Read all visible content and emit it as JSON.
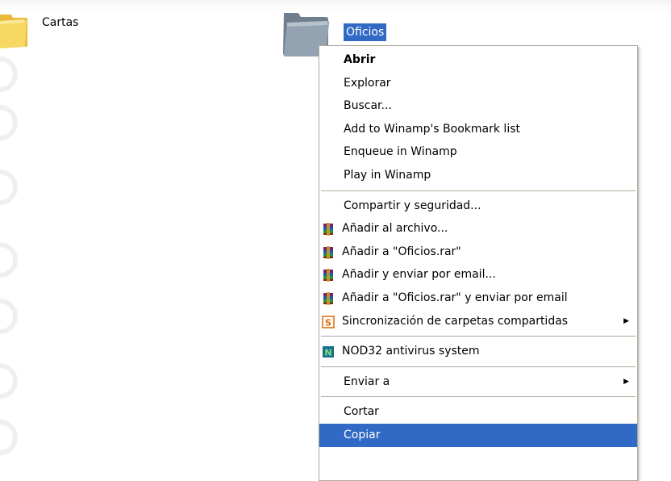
{
  "desktop": {
    "items": [
      {
        "label": "Cartas"
      },
      {
        "label": "Oficios"
      }
    ]
  },
  "context_menu": {
    "groups": [
      [
        {
          "label": "Abrir",
          "bold": true
        },
        {
          "label": "Explorar"
        },
        {
          "label": "Buscar..."
        },
        {
          "label": "Add to Winamp's Bookmark list"
        },
        {
          "label": "Enqueue in Winamp"
        },
        {
          "label": "Play in Winamp"
        }
      ],
      [
        {
          "label": "Compartir y seguridad..."
        },
        {
          "label": "Añadir al archivo...",
          "icon": "winrar-icon"
        },
        {
          "label": "Añadir a \"Oficios.rar\"",
          "icon": "winrar-icon"
        },
        {
          "label": "Añadir y enviar por email...",
          "icon": "winrar-icon"
        },
        {
          "label": "Añadir a \"Oficios.rar\" y enviar por email",
          "icon": "winrar-icon"
        },
        {
          "label": "Sincronización de carpetas compartidas",
          "icon": "sync-folders-icon",
          "submenu": true
        }
      ],
      [
        {
          "label": "NOD32 antivirus system",
          "icon": "nod32-icon"
        }
      ],
      [
        {
          "label": "Enviar a",
          "submenu": true
        }
      ],
      [
        {
          "label": "Cortar"
        },
        {
          "label": "Copiar",
          "highlighted": true
        }
      ]
    ]
  },
  "colors": {
    "selection": "#316ac5",
    "menu_border": "#aca899",
    "folder_yellow": "#f3d35a",
    "folder_gray": "#8a9aa8"
  }
}
